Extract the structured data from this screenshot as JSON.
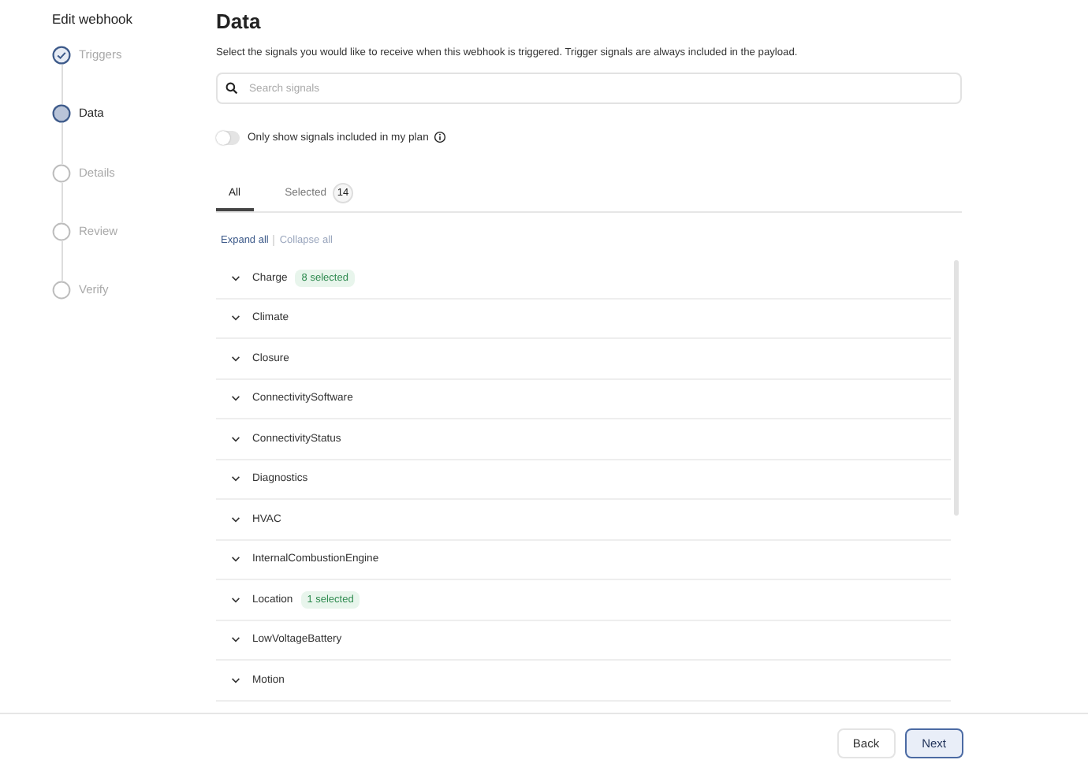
{
  "sidebar": {
    "title": "Edit webhook",
    "steps": [
      {
        "label": "Triggers",
        "kind": "done"
      },
      {
        "label": "Data",
        "kind": "current"
      },
      {
        "label": "Details",
        "kind": "pending"
      },
      {
        "label": "Review",
        "kind": "pending"
      },
      {
        "label": "Verify",
        "kind": "pending"
      }
    ]
  },
  "main": {
    "title": "Data",
    "description": "Select the signals you would like to receive when this webhook is triggered. Trigger signals are always included in the payload.",
    "search": {
      "placeholder": "Search signals"
    },
    "toggle": {
      "label": "Only show signals included in my plan",
      "on": false
    },
    "tabs": [
      {
        "label": "All",
        "selected": true
      },
      {
        "label": "Selected",
        "count": "14",
        "selected": false
      }
    ],
    "actions": [
      {
        "label": "Expand all",
        "disabled": false
      },
      {
        "label": "Collapse all",
        "disabled": true
      }
    ],
    "groups": [
      {
        "name": "Charge",
        "badge": "8 selected"
      },
      {
        "name": "Climate"
      },
      {
        "name": "Closure"
      },
      {
        "name": "ConnectivitySoftware"
      },
      {
        "name": "ConnectivityStatus"
      },
      {
        "name": "Diagnostics"
      },
      {
        "name": "HVAC"
      },
      {
        "name": "InternalCombustionEngine"
      },
      {
        "name": "Location",
        "badge": "1 selected"
      },
      {
        "name": "LowVoltageBattery"
      },
      {
        "name": "Motion"
      }
    ]
  },
  "footer": {
    "buttons": [
      {
        "label": "Back",
        "kind": "secondary"
      },
      {
        "label": "Next",
        "kind": "primary"
      }
    ]
  }
}
